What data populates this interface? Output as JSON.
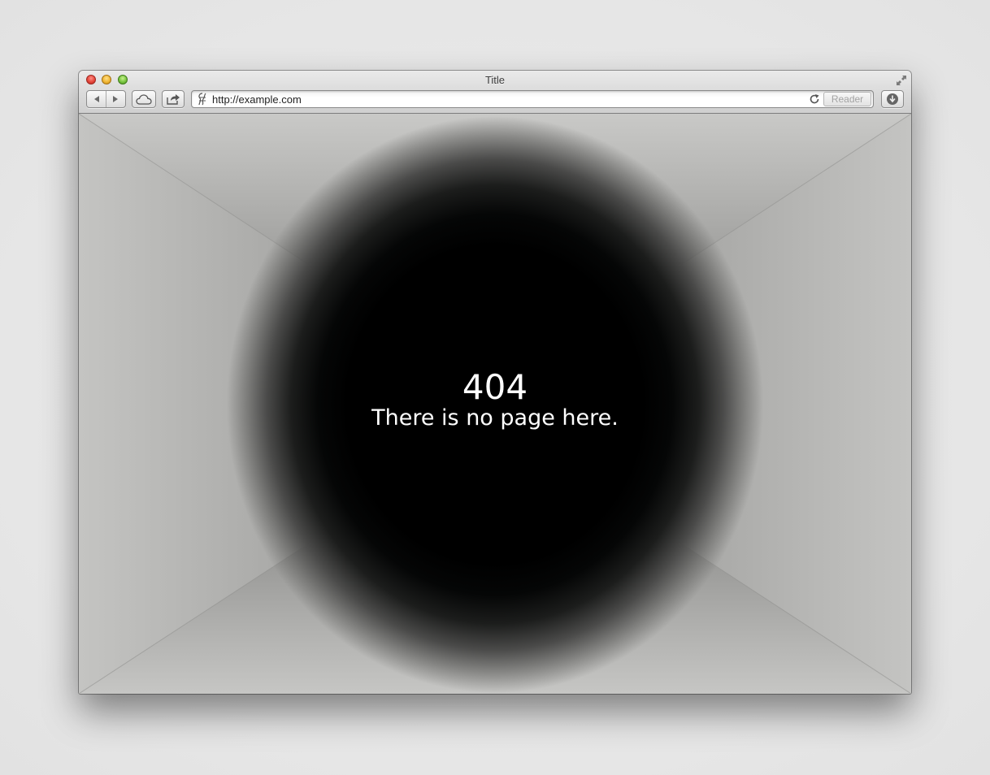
{
  "window": {
    "title": "Title"
  },
  "toolbar": {
    "back_icon": "back-arrow-icon",
    "forward_icon": "forward-arrow-icon",
    "cloud_icon": "icloud-icon",
    "share_icon": "share-icon",
    "download_icon": "downloads-icon",
    "address": {
      "url": "http://example.com",
      "site_icon": "site-icon",
      "reload_icon": "reload-icon",
      "reader_label": "Reader"
    }
  },
  "page": {
    "error_code": "404",
    "message": "There is no page here."
  },
  "colors": {
    "page_background": "#c5c5c3",
    "hole": "#000000",
    "text": "#ffffff"
  }
}
